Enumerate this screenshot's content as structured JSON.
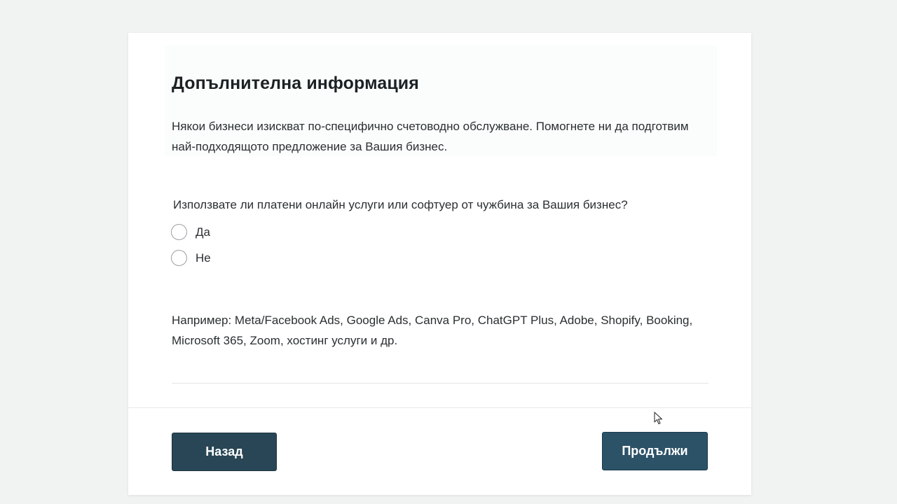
{
  "section": {
    "title": "Допълнителна информация",
    "description": "Някои бизнеси изискват по-специфично счетоводно обслужване. Помогнете ни да подготвим най-подходящото предложение за Вашия бизнес."
  },
  "question": {
    "text": "Използвате ли платени онлайн услуги или софтуер от чужбина за Вашия бизнес?",
    "options": [
      {
        "label": "Да",
        "selected": false
      },
      {
        "label": "Не",
        "selected": false
      }
    ]
  },
  "example": {
    "text": "Например: Meta/Facebook Ads, Google Ads, Canva Pro, ChatGPT Plus, Adobe, Shopify, Booking, Microsoft 365, Zoom, хостинг услуги и др."
  },
  "footer": {
    "back_label": "Назад",
    "next_label": "Продължи"
  },
  "colors": {
    "button_primary": "#2c5268",
    "button_back": "#284656",
    "page_background": "#f1f3f3"
  },
  "icons": {
    "cursor": "mouse-pointer-icon"
  }
}
